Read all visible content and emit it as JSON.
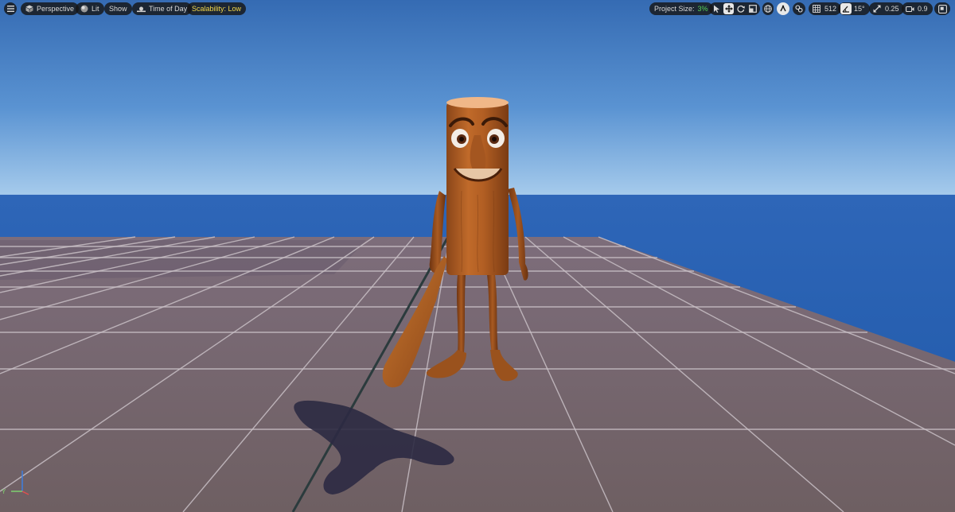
{
  "toolbar": {
    "perspective_label": "Perspective",
    "lit_label": "Lit",
    "show_label": "Show",
    "time_of_day_label": "Time of Day",
    "scalability_label": "Scalability: Low",
    "project_size_label": "Project Size:",
    "project_size_value": "3%",
    "grid_snap_value": "512",
    "rotation_snap_value": "15°",
    "scale_snap_value": "0.25",
    "camera_speed_value": "0.9"
  },
  "icons": {
    "menu": "hamburger-menu-icon",
    "perspective": "cube-icon",
    "lit": "sphere-icon",
    "time_of_day": "sun-landscape-icon",
    "select": "pointer-arrow-icon",
    "translate": "move-arrows-icon",
    "rotate": "rotate-icon",
    "scale": "scale-icon",
    "world_local": "globe-icon",
    "surface_snap": "surface-snap-icon",
    "camera": "camera-icon",
    "maximize": "maximize-icon"
  },
  "colors": {
    "accent_yellow": "#f2d64b",
    "project_size_green": "#57d058",
    "toolbar_bg": "#161616"
  },
  "axis_gizmo": {
    "x": "X",
    "y": "Y",
    "z": "Z"
  }
}
